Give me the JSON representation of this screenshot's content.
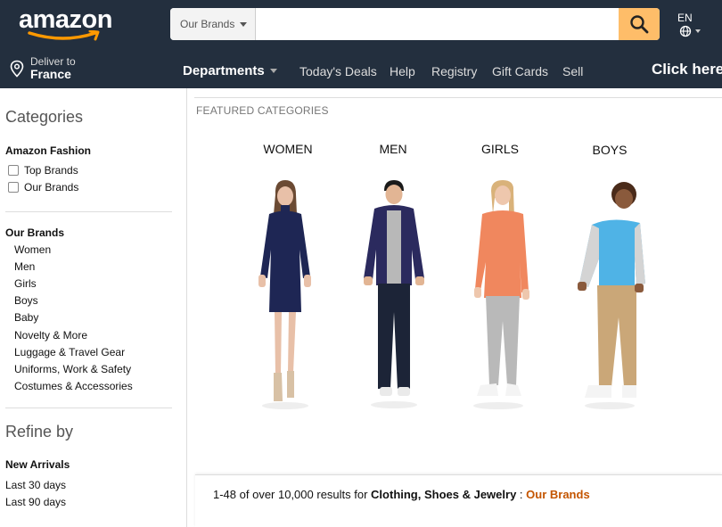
{
  "header": {
    "logo_text": "amazon",
    "search": {
      "dropdown_label": "Our Brands",
      "placeholder": "",
      "value": ""
    },
    "language": "EN",
    "deliver_line1": "Deliver to",
    "deliver_line2": "France"
  },
  "nav": {
    "departments": "Departments",
    "links": [
      "Today's Deals",
      "Help",
      "Registry",
      "Gift Cards",
      "Sell"
    ],
    "cta": "Click here"
  },
  "sidebar": {
    "categories_heading": "Categories",
    "fashion_heading": "Amazon Fashion",
    "checkboxes": [
      "Top Brands",
      "Our Brands"
    ],
    "our_brands_heading": "Our Brands",
    "brand_links": [
      "Women",
      "Men",
      "Girls",
      "Boys",
      "Baby",
      "Novelty & More",
      "Luggage & Travel Gear",
      "Uniforms, Work & Safety",
      "Costumes & Accessories"
    ],
    "refine_heading": "Refine by",
    "new_arrivals_heading": "New Arrivals",
    "arrival_links": [
      "Last 30 days",
      "Last 90 days"
    ]
  },
  "main": {
    "featured_heading": "FEATURED CATEGORIES",
    "categories": [
      "WOMEN",
      "MEN",
      "GIRLS",
      "BOYS"
    ]
  },
  "results": {
    "prefix": "1-48 of over 10,000 results for ",
    "query": "Clothing, Shoes & Jewelry",
    "separator": " : ",
    "brand": "Our Brands"
  },
  "colors": {
    "header_bg": "#232f3e",
    "search_button": "#febd69",
    "logo_smile": "#ff9900",
    "brand_link": "#c45500"
  }
}
